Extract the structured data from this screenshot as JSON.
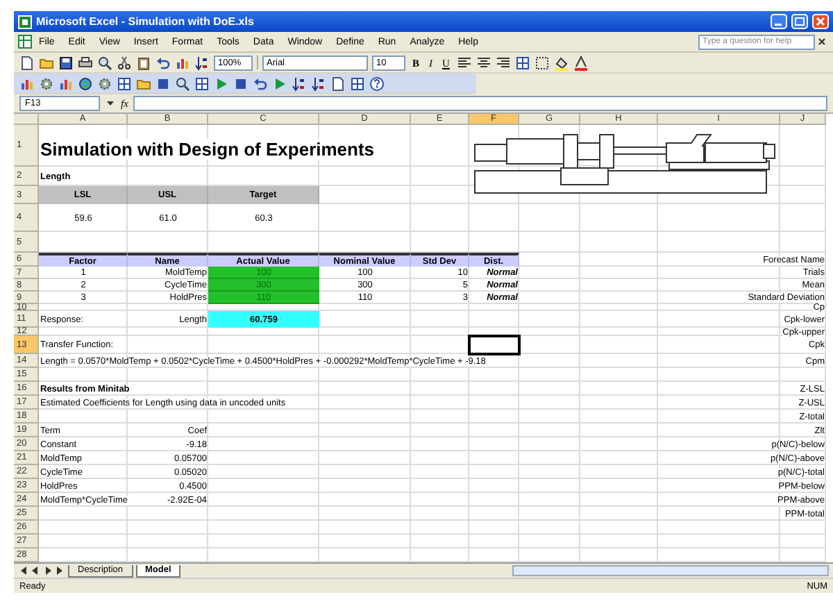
{
  "window": {
    "title": "Microsoft Excel - Simulation with DoE.xls"
  },
  "menu": [
    "File",
    "Edit",
    "View",
    "Insert",
    "Format",
    "Tools",
    "Data",
    "Window",
    "Define",
    "Run",
    "Analyze",
    "Help"
  ],
  "help_box": {
    "placeholder": "Type a question for help"
  },
  "formatting": {
    "zoom": "100%",
    "font": "Arial",
    "size": "10",
    "style_buttons": [
      "B",
      "I",
      "U"
    ]
  },
  "name_box": "F13",
  "function_label": "fx",
  "columns": [
    "A",
    "B",
    "C",
    "D",
    "E",
    "F",
    "G",
    "H",
    "I",
    "J"
  ],
  "rows": [
    {
      "number": "1",
      "cells": {
        "A": {
          "kind": "title",
          "text": "Simulation with Design of Experiments"
        }
      }
    },
    {
      "number": "2",
      "cells": {
        "A": {
          "kind": "bold",
          "text": "Length"
        }
      }
    },
    {
      "number": "3",
      "cells": {
        "A": {
          "kind": "header-gray",
          "text": "LSL"
        },
        "B": {
          "kind": "header-gray",
          "text": "USL"
        },
        "C": {
          "kind": "header-gray",
          "text": "Target"
        }
      }
    },
    {
      "number": "4",
      "cells": {
        "A": {
          "kind": "center",
          "text": "59.6"
        },
        "B": {
          "kind": "center",
          "text": "61.0"
        },
        "C": {
          "kind": "center",
          "text": "60.3"
        }
      }
    },
    {
      "number": "5"
    },
    {
      "number": "6",
      "cells": {
        "A": {
          "kind": "header-blue",
          "text": "Factor"
        },
        "B": {
          "kind": "header-blue",
          "text": "Name"
        },
        "C": {
          "kind": "header-blue",
          "text": "Actual Value"
        },
        "D": {
          "kind": "header-blue",
          "text": "Nominal Value"
        },
        "E": {
          "kind": "header-blue",
          "text": "Std Dev"
        },
        "F": {
          "kind": "header-blue",
          "text": "Dist."
        },
        "J": {
          "kind": "right",
          "text": "Forecast Name"
        }
      }
    },
    {
      "number": "7",
      "cells": {
        "A": {
          "kind": "center",
          "text": "1"
        },
        "B": {
          "kind": "right",
          "text": "MoldTemp"
        },
        "C": {
          "kind": "green",
          "text": "100"
        },
        "D": {
          "kind": "center",
          "text": "100"
        },
        "E": {
          "kind": "right",
          "text": "10"
        },
        "F": {
          "kind": "dist",
          "text": "Normal"
        },
        "J": {
          "kind": "right",
          "text": "Trials"
        }
      }
    },
    {
      "number": "8",
      "cells": {
        "A": {
          "kind": "center",
          "text": "2"
        },
        "B": {
          "kind": "right",
          "text": "CycleTime"
        },
        "C": {
          "kind": "green",
          "text": "300"
        },
        "D": {
          "kind": "center",
          "text": "300"
        },
        "E": {
          "kind": "right",
          "text": "5"
        },
        "F": {
          "kind": "dist",
          "text": "Normal"
        },
        "J": {
          "kind": "right",
          "text": "Mean"
        }
      }
    },
    {
      "number": "9",
      "cells": {
        "A": {
          "kind": "center",
          "text": "3"
        },
        "B": {
          "kind": "right",
          "text": "HoldPres"
        },
        "C": {
          "kind": "green",
          "text": "110"
        },
        "D": {
          "kind": "center",
          "text": "110"
        },
        "E": {
          "kind": "right",
          "text": "3"
        },
        "F": {
          "kind": "dist",
          "text": "Normal"
        },
        "J": {
          "kind": "right",
          "text": "Standard Deviation"
        }
      }
    },
    {
      "number": "10",
      "cells": {
        "J": {
          "kind": "right",
          "text": "Cp"
        }
      }
    },
    {
      "number": "11",
      "cells": {
        "A": {
          "kind": "text",
          "text": "Response:"
        },
        "B": {
          "kind": "right",
          "text": "Length"
        },
        "C": {
          "kind": "cyan",
          "text": "60.759"
        },
        "J": {
          "kind": "right",
          "text": "Cpk-lower"
        }
      }
    },
    {
      "number": "12",
      "cells": {
        "J": {
          "kind": "right",
          "text": "Cpk-upper"
        }
      }
    },
    {
      "number": "13",
      "cells": {
        "A": {
          "kind": "text",
          "text": "Transfer Function:"
        },
        "J": {
          "kind": "right",
          "text": "Cpk"
        }
      }
    },
    {
      "number": "14",
      "cells": {
        "A": {
          "kind": "text",
          "text": "Length = 0.0570*MoldTemp + 0.0502*CycleTime + 0.4500*HoldPres + -0.000292*MoldTemp*CycleTime + -9.18"
        },
        "J": {
          "kind": "right",
          "text": "Cpm"
        }
      }
    },
    {
      "number": "15"
    },
    {
      "number": "16",
      "cells": {
        "A": {
          "kind": "bold",
          "text": "Results from Minitab"
        },
        "J": {
          "kind": "right",
          "text": "Z-LSL"
        }
      }
    },
    {
      "number": "17",
      "cells": {
        "A": {
          "kind": "text",
          "text": "Estimated Coefficients for Length using data in uncoded units"
        },
        "J": {
          "kind": "right",
          "text": "Z-USL"
        }
      }
    },
    {
      "number": "18",
      "cells": {
        "J": {
          "kind": "right",
          "text": "Z-total"
        }
      }
    },
    {
      "number": "19",
      "cells": {
        "A": {
          "kind": "text",
          "text": "Term"
        },
        "B": {
          "kind": "right",
          "text": "Coef"
        },
        "J": {
          "kind": "right",
          "text": "Zlt"
        }
      }
    },
    {
      "number": "20",
      "cells": {
        "A": {
          "kind": "text",
          "text": "Constant"
        },
        "B": {
          "kind": "right",
          "text": "-9.18"
        },
        "J": {
          "kind": "right",
          "text": "p(N/C)-below"
        }
      }
    },
    {
      "number": "21",
      "cells": {
        "A": {
          "kind": "text",
          "text": "MoldTemp"
        },
        "B": {
          "kind": "right",
          "text": "0.05700"
        },
        "J": {
          "kind": "right",
          "text": "p(N/C)-above"
        }
      }
    },
    {
      "number": "22",
      "cells": {
        "A": {
          "kind": "text",
          "text": "CycleTime"
        },
        "B": {
          "kind": "right",
          "text": "0.05020"
        },
        "J": {
          "kind": "right",
          "text": "p(N/C)-total"
        }
      }
    },
    {
      "number": "23",
      "cells": {
        "A": {
          "kind": "text",
          "text": "HoldPres"
        },
        "B": {
          "kind": "right",
          "text": "0.4500"
        },
        "J": {
          "kind": "right",
          "text": "PPM-below"
        }
      }
    },
    {
      "number": "24",
      "cells": {
        "A": {
          "kind": "text",
          "text": "MoldTemp*CycleTime"
        },
        "B": {
          "kind": "right",
          "text": "-2.92E-04"
        },
        "J": {
          "kind": "right",
          "text": "PPM-above"
        }
      }
    },
    {
      "number": "25",
      "cells": {
        "J": {
          "kind": "right",
          "text": "PPM-total"
        }
      }
    },
    {
      "number": "26"
    },
    {
      "number": "27"
    },
    {
      "number": "28"
    }
  ],
  "sheet_tabs": [
    {
      "label": "Description",
      "selected": false
    },
    {
      "label": "Model",
      "selected": true
    }
  ],
  "status_bar": {
    "left": "Ready",
    "right": "NUM"
  }
}
